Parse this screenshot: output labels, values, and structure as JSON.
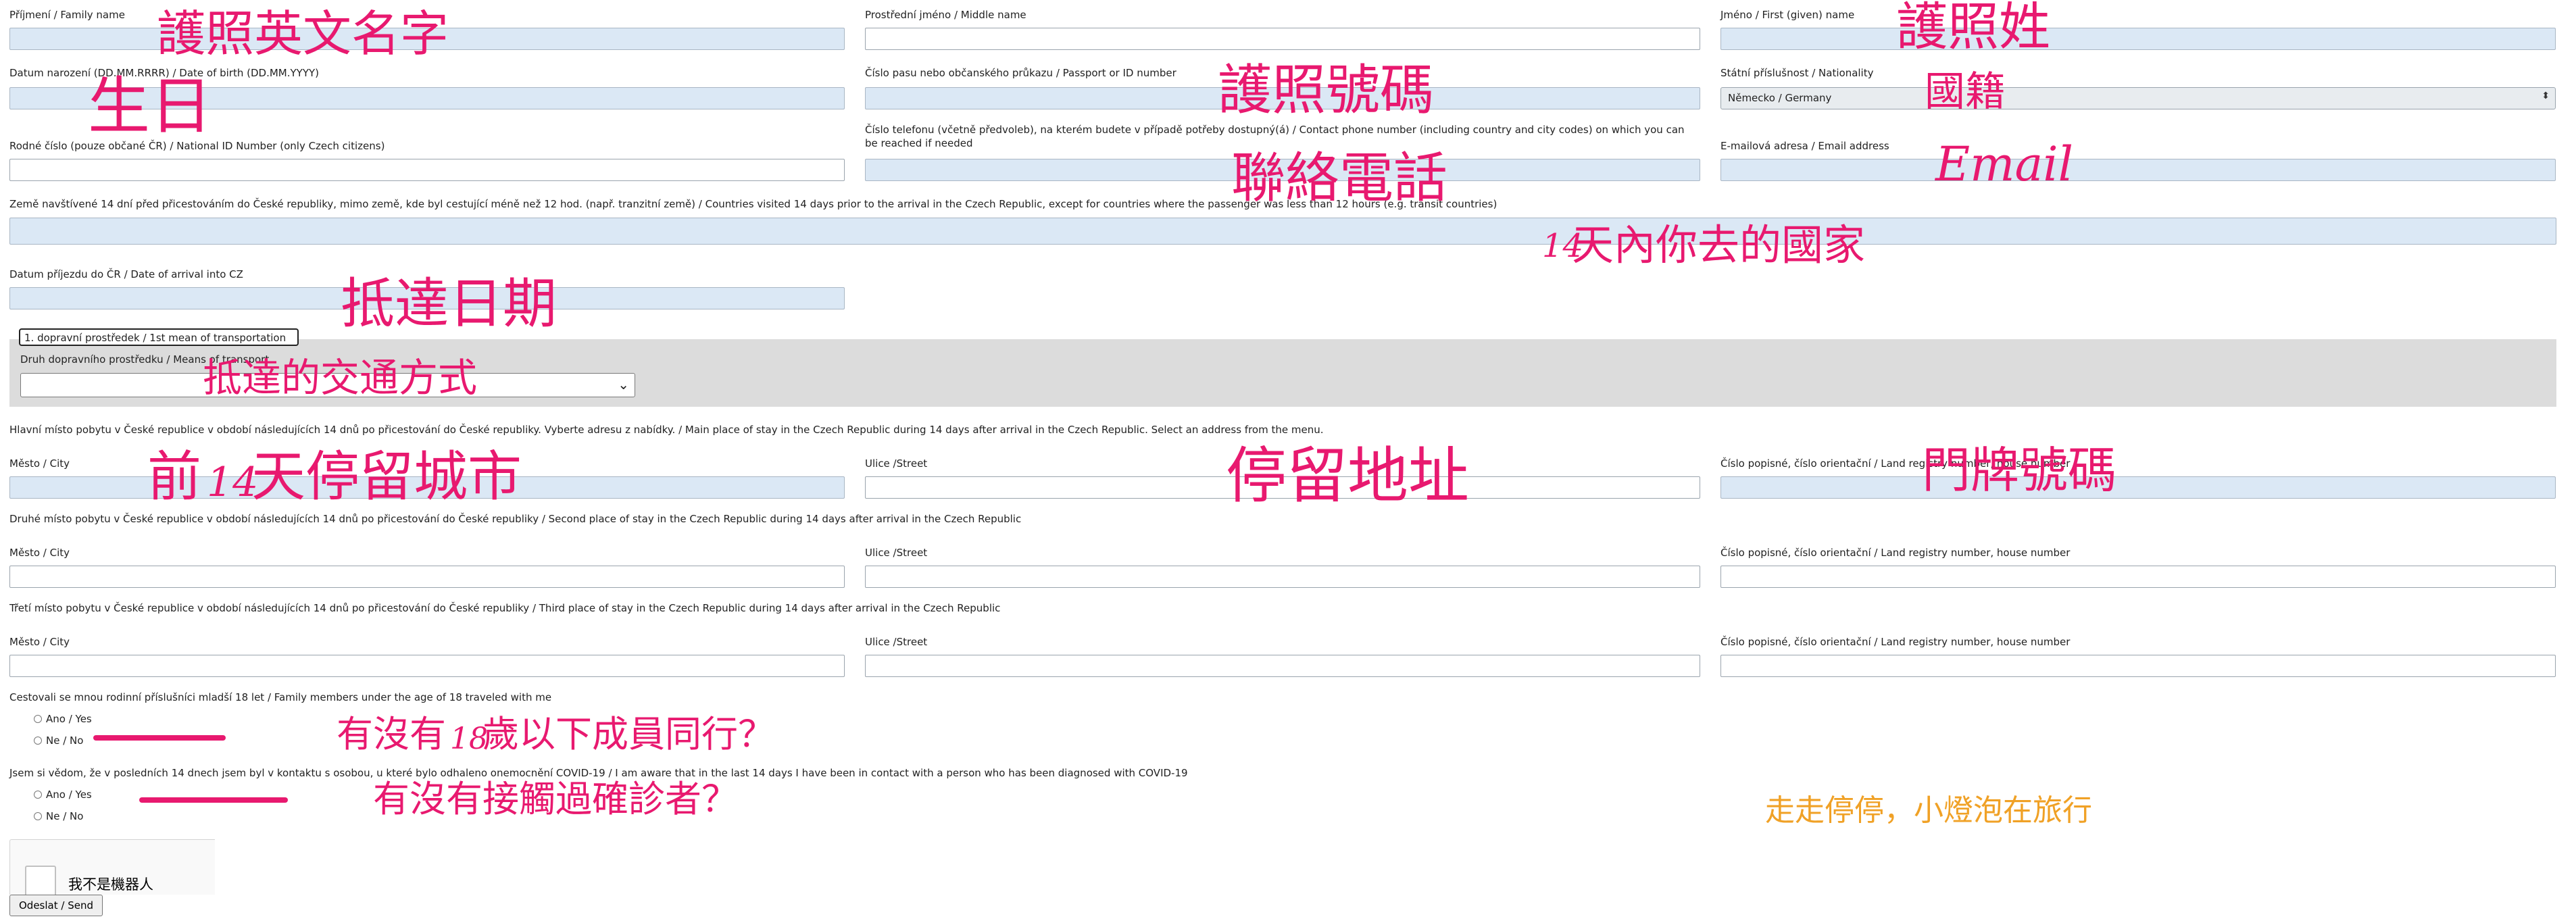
{
  "form": {
    "family_name_label": "Příjmení / Family name",
    "middle_name_label": "Prostřední jméno / Middle name",
    "first_name_label": "Jméno / First (given) name",
    "dob_label": "Datum narození (DD.MM.RRRR) / Date of birth (DD.MM.YYYY)",
    "passport_label": "Číslo pasu nebo občanského průkazu / Passport or ID number",
    "nationality_label": "Státní příslušnost / Nationality",
    "nationality_value": "Německo / Germany",
    "national_id_label": "Rodné číslo (pouze občané ČR) / National ID Number (only Czech citizens)",
    "phone_label": "Číslo telefonu (včetně předvoleb), na kterém budete v případě potřeby dostupný(á) / Contact phone number (including country and city codes) on which you can be reached if needed",
    "email_label": "E-mailová adresa / Email address",
    "countries_label": "Země navštívené 14 dní před přicestováním do České republiky, mimo země, kde byl cestující méně než 12 hod. (např. tranzitní země) / Countries visited 14 days prior to the arrival in the Czech Republic, except for countries where the passenger was less than 12 hours (e.g. transit countries)",
    "arrival_date_label": "Datum příjezdu do ČR / Date of arrival into CZ",
    "transport_legend": "1. dopravní prostředek / 1st mean of transportation",
    "transport_type_label": "Druh dopravního prostředku / Means of transport",
    "main_stay_label": "Hlavní místo pobytu v České republice v období následujících 14 dnů po přicestování do České republiky. Vyberte adresu z nabídky. / Main place of stay in the Czech Republic during 14 days after arrival in the Czech Republic. Select an address from the menu.",
    "second_stay_label": "Druhé místo pobytu v České republice v období následujících 14 dnů po přicestování do České republiky / Second place of stay in the Czech Republic during 14 days after arrival in the Czech Republic",
    "third_stay_label": "Třetí místo pobytu v České republice v období následujících 14 dnů po přicestování do České republiky / Third place of stay in the Czech Republic during 14 days after arrival in the Czech Republic",
    "city_label": "Město / City",
    "street_label": "Ulice /Street",
    "house_number_label": "Číslo popisné, číslo orientační / Land registry number, house number",
    "family_members_label": "Cestovali se mnou rodinní příslušníci mladší 18 let / Family members under the age of 18 traveled with me",
    "covid_contact_label": "Jsem si vědom, že v posledních 14 dnech jsem byl v kontaktu s osobou, u které bylo odhaleno onemocnění COVID-19 / I am aware that in the last 14 days I have been in contact with a person who has been diagnosed with COVID-19",
    "yes_label": "Ano / Yes",
    "no_label": "Ne / No",
    "captcha_label": "我不是機器人",
    "send_label": "Odeslat / Send"
  },
  "annotations": {
    "family_name": "護照英文名字",
    "birthday": "生日",
    "passport_no": "護照號碼",
    "surname": "護照姓",
    "nationality": "國籍",
    "phone": "聯絡電話",
    "email": "Email",
    "countries": "天內你去的國家",
    "days_14_a": "14",
    "arrival_date": "抵達日期",
    "transport": "抵達的交通方式",
    "prefix_front": "前",
    "days_14_b": "14",
    "stay_city": "天停留城市",
    "stay_address": "停留地址",
    "house_number": "門牌號碼",
    "age_18": "18",
    "minors_q_a": "有沒有",
    "minors_q_b": "歲以下成員同行？",
    "contact_q": "有沒有接觸過確診者？",
    "watermark": "走走停停，小燈泡在旅行"
  },
  "colors": {
    "annotation": "#e8196f",
    "watermark": "#f0a126",
    "input_fill": "#dbe8f5"
  }
}
